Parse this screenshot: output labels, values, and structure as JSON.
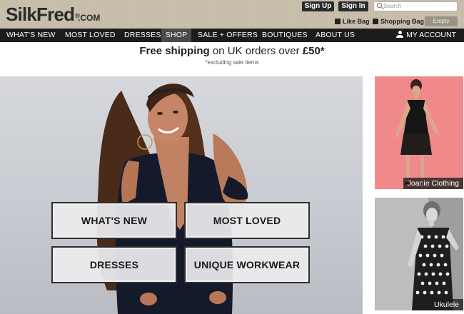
{
  "logo": {
    "main": "SilkFred",
    "reg": "®",
    "tld": ".COM"
  },
  "header": {
    "sign_up": "Sign Up",
    "sign_in": "Sign In",
    "search_placeholder": "Search",
    "like_bag": "Like Bag",
    "shopping_bag": "Shopping Bag",
    "empty": "Empty"
  },
  "nav": {
    "items": [
      {
        "label": "WHAT'S NEW"
      },
      {
        "label": "MOST LOVED"
      },
      {
        "label": "DRESSES"
      },
      {
        "label": "SHOP",
        "active": true
      },
      {
        "label": "SALE + OFFERS"
      },
      {
        "label": "BOUTIQUES"
      },
      {
        "label": "ABOUT US"
      }
    ],
    "account": "MY ACCOUNT"
  },
  "promo": {
    "bold": "Free shipping",
    "middle": " on UK orders over ",
    "amount": "£50*",
    "note": "*excluding sale items"
  },
  "hero": {
    "tiles": [
      "WHAT'S NEW",
      "MOST LOVED",
      "DRESSES",
      "UNIQUE WORKWEAR"
    ]
  },
  "side_cards": [
    {
      "label": "Joanie Clothing"
    },
    {
      "label": "Ukulele"
    }
  ],
  "colors": {
    "header_bg": "#c6bdab",
    "nav_bg": "#1c1c1c",
    "nav_active": "#4a4a4a",
    "card1_bg": "#f0898a"
  }
}
